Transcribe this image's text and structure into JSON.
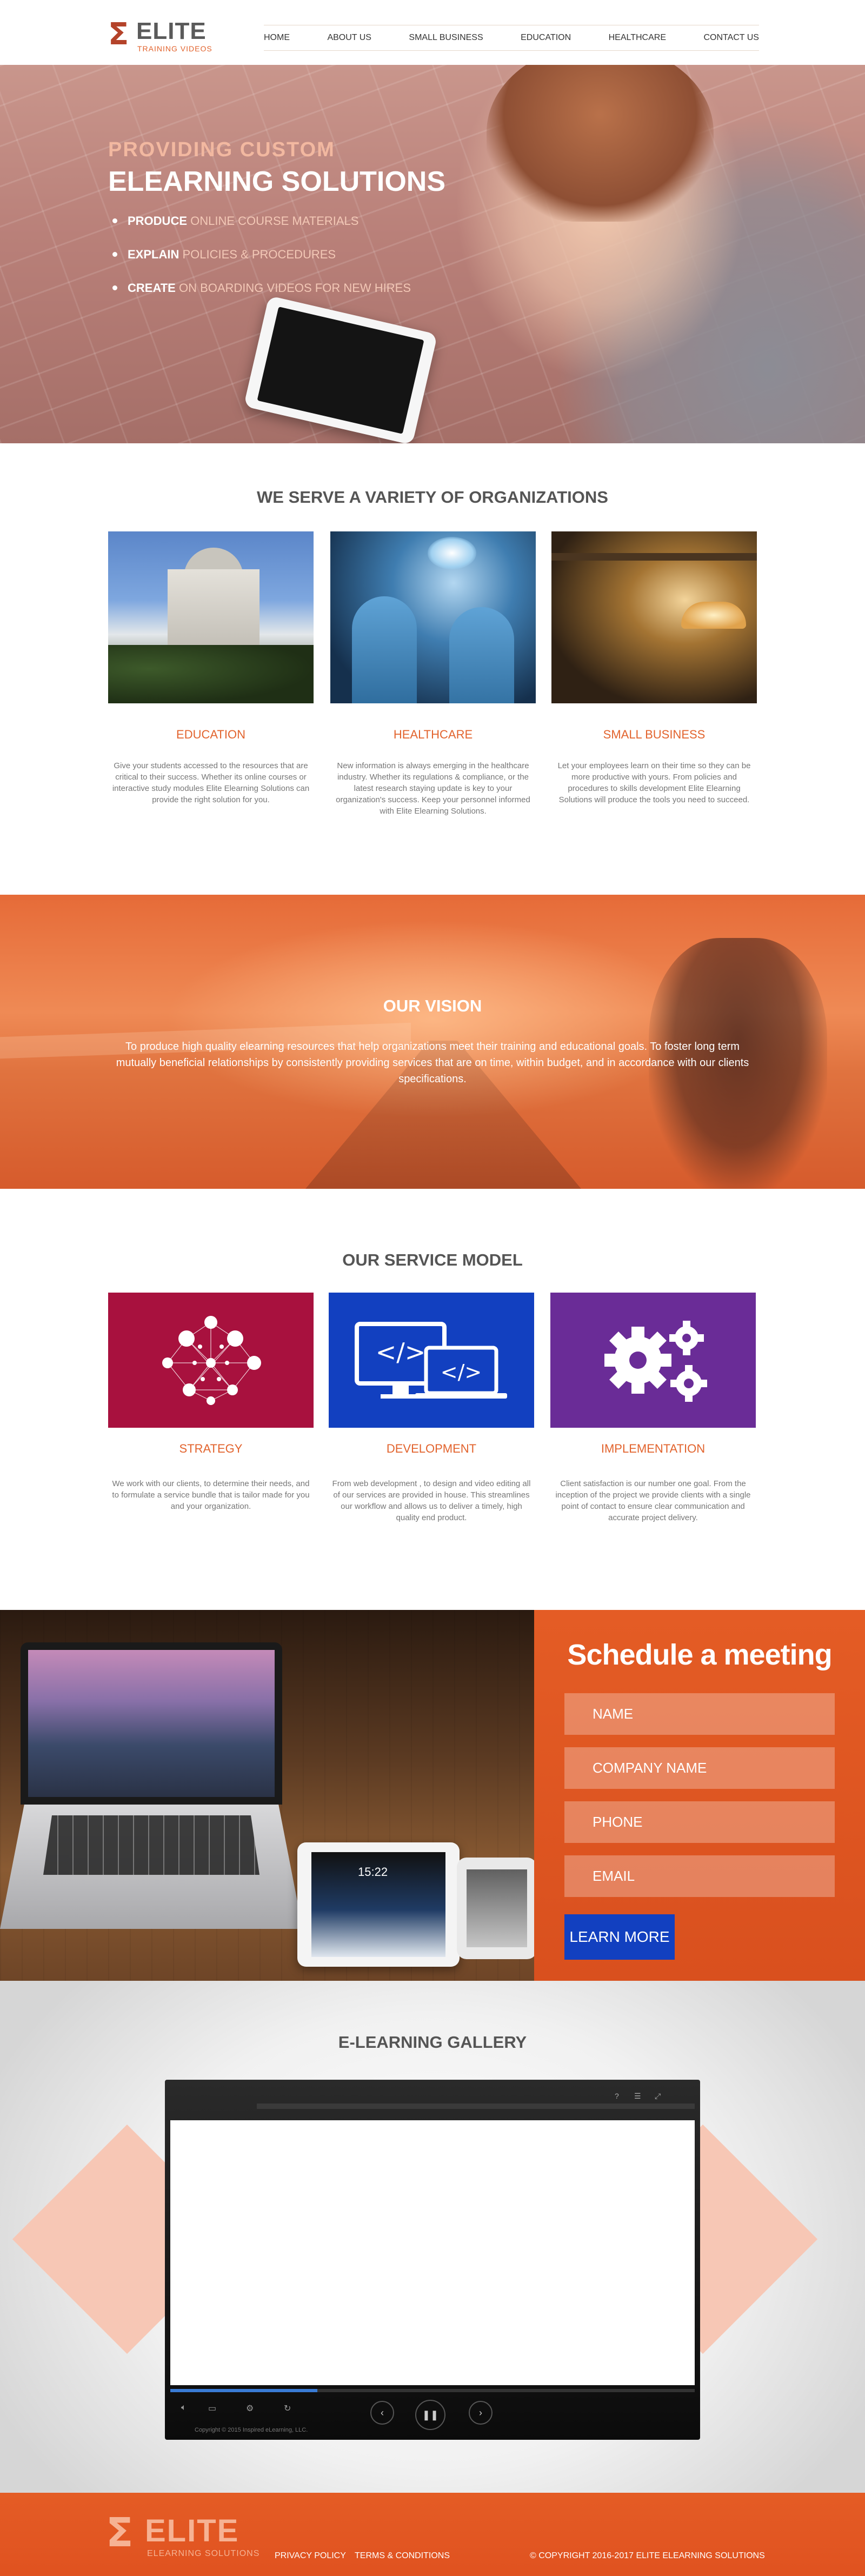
{
  "brand": {
    "logo_glyph": "Σ",
    "name": "ELITE",
    "tagline": "TRAINING VIDEOS",
    "accent_color": "#e2632d"
  },
  "nav": {
    "items": [
      "HOME",
      "ABOUT US",
      "SMALL BUSINESS",
      "EDUCATION",
      "HEALTHCARE",
      "CONTACT US"
    ]
  },
  "hero": {
    "kicker": "PROVIDING CUSTOM",
    "title": "ELEARNING SOLUTIONS",
    "bullets": [
      {
        "bold": "PRODUCE",
        "text": "ONLINE COURSE MATERIALS"
      },
      {
        "bold": "EXPLAIN",
        "text": "POLICIES & PROCEDURES"
      },
      {
        "bold": "CREATE",
        "text": "ON BOARDING VIDEOS FOR NEW HIRES"
      }
    ]
  },
  "organizations": {
    "title": "WE SERVE A VARIETY OF ORGANIZATIONS",
    "items": [
      {
        "label": "EDUCATION",
        "text": "Give your students accessed to the resources that are critical to their success. Whether its online courses or interactive study modules Elite Elearning Solutions can provide the right solution for you."
      },
      {
        "label": "HEALTHCARE",
        "text": "New information is always emerging in the healthcare industry. Whether its regulations & compliance, or the latest research staying update is key to your organization's success. Keep your personnel informed with Elite Elearning Solutions."
      },
      {
        "label": "SMALL BUSINESS",
        "text": "Let your employees learn on their time so they can be more productive with yours. From policies and procedures to skills development Elite Elearning Solutions will produce the tools you need to succeed."
      }
    ]
  },
  "vision": {
    "title": "OUR VISION",
    "text": "To produce high quality elearning resources that help organizations meet their training and educational goals. To foster long term mutually beneficial relationships by consistently providing services that are on time, within budget, and in accordance with our clients specifications."
  },
  "services": {
    "title": "OUR SERVICE MODEL",
    "items": [
      {
        "label": "STRATEGY",
        "icon": "network-icon",
        "color": "#a8113e",
        "text": "We work with our clients, to determine their needs, and to formulate a service bundle that is tailor made for you and your organization."
      },
      {
        "label": "DEVELOPMENT",
        "icon": "code-monitors-icon",
        "color": "#1240c0",
        "text": "From web development , to design and video editing all of our services are provided in house. This streamlines our workflow and allows us to deliver a timely, high quality end product."
      },
      {
        "label": "IMPLEMENTATION",
        "icon": "gears-icon",
        "color": "#6a2c97",
        "text": "Client satisfaction is our number one goal. From the inception of the project we provide clients with a single point of contact to ensure clear communication and accurate project delivery."
      }
    ]
  },
  "schedule": {
    "title": "Schedule a meeting",
    "fields": {
      "name": "NAME",
      "company": "COMPANY NAME",
      "phone": "PHONE",
      "email": "EMAIL"
    },
    "button": "LEARN MORE",
    "tablet_time": "15:22"
  },
  "gallery": {
    "title": "E-LEARNING  GALLERY",
    "video_copyright": "Copyright © 2015 Inspired eLearning, LLC.",
    "progress": 0.28
  },
  "footer": {
    "name": "ELITE",
    "tagline": "ELEARNING SOLUTIONS",
    "privacy": "PRIVACY POLICY",
    "terms": "TERMS & CONDITIONS",
    "copyright": "© COPYRIGHT 2016-2017 ELITE ELEARNING SOLUTIONS"
  }
}
